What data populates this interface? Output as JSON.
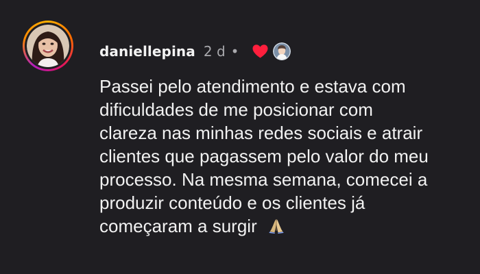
{
  "comment": {
    "username": "daniellepina",
    "time": "2 d",
    "separator": "•",
    "text_lines": [
      "Passei pelo atendimento e estava com",
      "dificuldades de me posicionar com",
      "clareza nas minhas redes sociais e atrair",
      "clientes que pagassem pelo valor do meu",
      "processo. Na mesma semana, comecei a",
      "produzir conteúdo e os clientes já",
      "começaram a surgir"
    ],
    "icons": {
      "avatar": "user-avatar-photo",
      "liked_by_author": "heart-icon",
      "liker_avatar": "mini-avatar",
      "emoji": "praying-hands-icon"
    },
    "colors": {
      "background": "#1f1e22",
      "text": "#f2f2f2",
      "secondary_text": "#a9a9ad",
      "heart": "#ff1f3d"
    }
  }
}
